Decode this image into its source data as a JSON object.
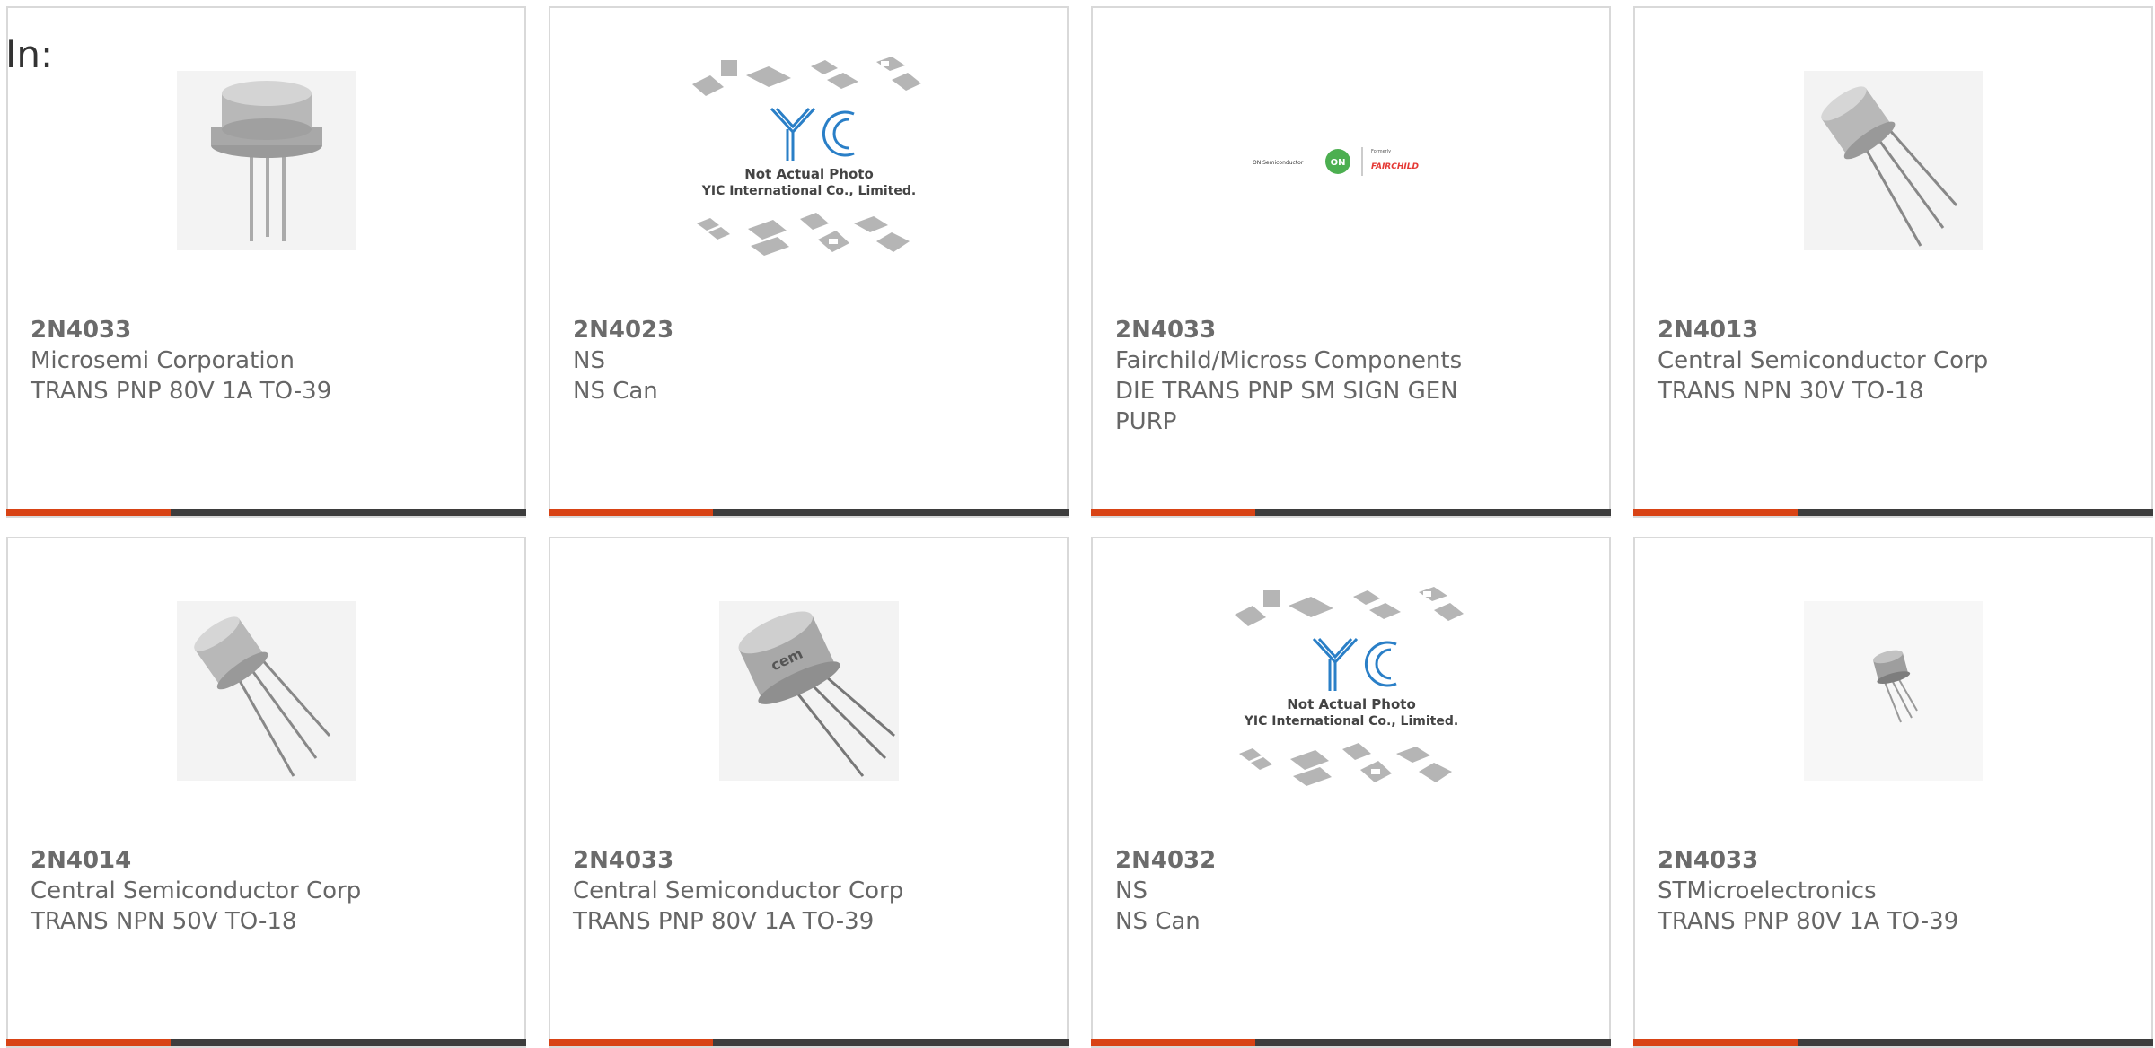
{
  "page": {
    "label": "In:"
  },
  "cards": [
    {
      "part": "2N4033",
      "manufacturer": "Microsemi Corporation",
      "description": "TRANS PNP 80V 1A TO-39",
      "image": "to39-can-photo"
    },
    {
      "part": "2N4023",
      "manufacturer": "NS",
      "description": "NS Can",
      "image": "yic-placeholder",
      "caption1": "Not Actual Photo",
      "caption2": "YIC International Co., Limited."
    },
    {
      "part": "2N4033",
      "manufacturer": "Fairchild/Micross Components",
      "description": "DIE TRANS PNP SM SIGN GEN PURP",
      "image": "onsemi-fairchild-logo",
      "logo_text1": "ON Semiconductor",
      "logo_text2": "Formerly",
      "logo_text3": "FAIRCHILD"
    },
    {
      "part": "2N4013",
      "manufacturer": "Central Semiconductor Corp",
      "description": "TRANS NPN 30V TO-18",
      "image": "to18-can-photo"
    },
    {
      "part": "2N4014",
      "manufacturer": "Central Semiconductor Corp",
      "description": "TRANS NPN 50V TO-18",
      "image": "to18-can-photo"
    },
    {
      "part": "2N4033",
      "manufacturer": "Central Semiconductor Corp",
      "description": "TRANS PNP 80V 1A TO-39",
      "image": "to39-can-cem-photo"
    },
    {
      "part": "2N4032",
      "manufacturer": "NS",
      "description": "NS Can",
      "image": "yic-placeholder",
      "caption1": "Not Actual Photo",
      "caption2": "YIC International Co., Limited."
    },
    {
      "part": "2N4033",
      "manufacturer": "STMicroelectronics",
      "description": "TRANS PNP 80V 1A TO-39",
      "image": "small-can-photo"
    }
  ],
  "colors": {
    "accent": "#d84315",
    "bar": "#3d3d3d",
    "border": "#d9d9d9",
    "text": "#666666"
  }
}
